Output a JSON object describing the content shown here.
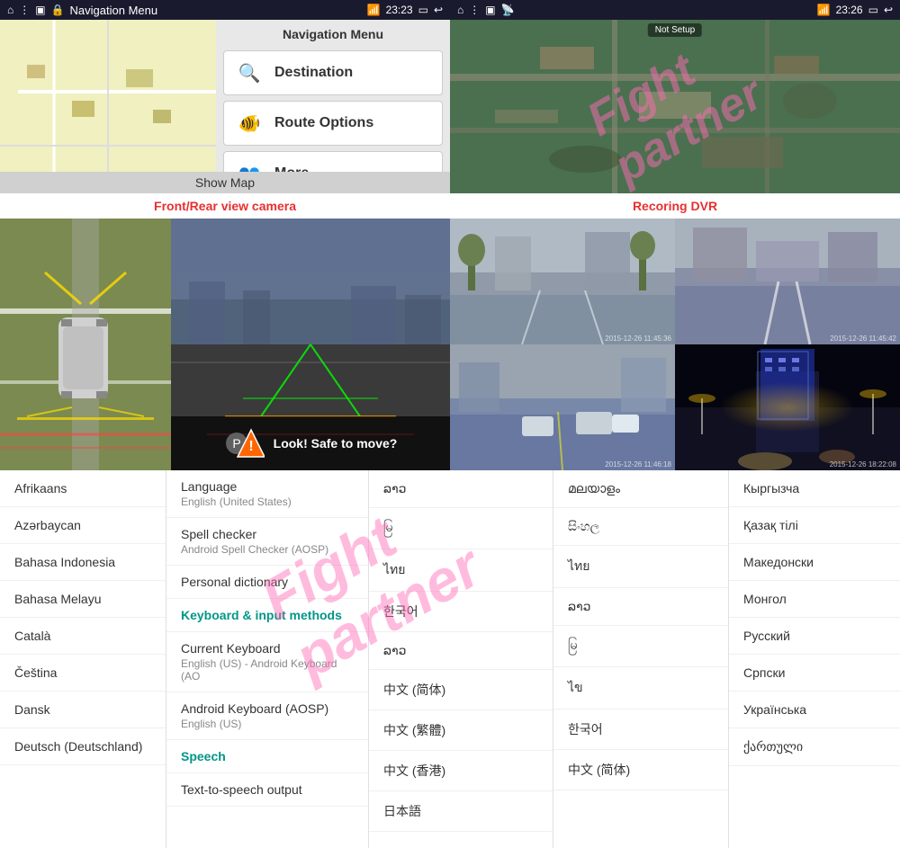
{
  "nav": {
    "title": "Navigation Menu",
    "time": "23:23",
    "menu_items": [
      {
        "label": "Destination",
        "icon": "🔍"
      },
      {
        "label": "Route Options",
        "icon": "🐠"
      },
      {
        "label": "More...",
        "icon": "👥"
      }
    ],
    "show_map": "Show Map"
  },
  "gps": {
    "time": "23:26",
    "not_setup": "Not Setup"
  },
  "labels": {
    "left": "Front/Rear view camera",
    "right": "Recoring DVR"
  },
  "camera": {
    "warning_text": "Look! Safe to move?"
  },
  "settings": {
    "languages_col1": [
      "Afrikaans",
      "Azərbaycan",
      "Bahasa Indonesia",
      "Bahasa Melayu",
      "Català",
      "Čeština",
      "Dansk",
      "Deutsch (Deutschland)"
    ],
    "col2_items": [
      {
        "title": "Language",
        "subtitle": "English (United States)"
      },
      {
        "title": "Spell checker",
        "subtitle": "Android Spell Checker (AOSP)"
      },
      {
        "title": "Personal dictionary",
        "subtitle": ""
      },
      {
        "title": "Keyboard & input methods",
        "subtitle": "",
        "teal": true
      },
      {
        "title": "Current Keyboard",
        "subtitle": "English (US) - Android Keyboard (AO"
      },
      {
        "title": "Android Keyboard (AOSP)",
        "subtitle": "English (US)"
      },
      {
        "title": "Speech",
        "subtitle": "",
        "teal": true
      },
      {
        "title": "Text-to-speech output",
        "subtitle": ""
      }
    ],
    "languages_col3": [
      "ລາວ",
      " မြ",
      "ไทย",
      "한국어",
      "ລາວ",
      "中文 (简体)",
      "中文 (繁體)",
      "中文 (香港)",
      "日本語"
    ],
    "languages_col4": [
      "മലയാളം",
      "සිංහල",
      "ไทย",
      "ລາວ",
      "မြ",
      "ไข",
      "한국어",
      "中文 (简体)"
    ],
    "languages_col5": [
      "Кыргызча",
      "Қазақ тілі",
      "Македонски",
      "Монгол",
      "Русский",
      "Српски",
      "Українська",
      "ქართული"
    ]
  },
  "watermark": {
    "text": "Fight partner"
  }
}
